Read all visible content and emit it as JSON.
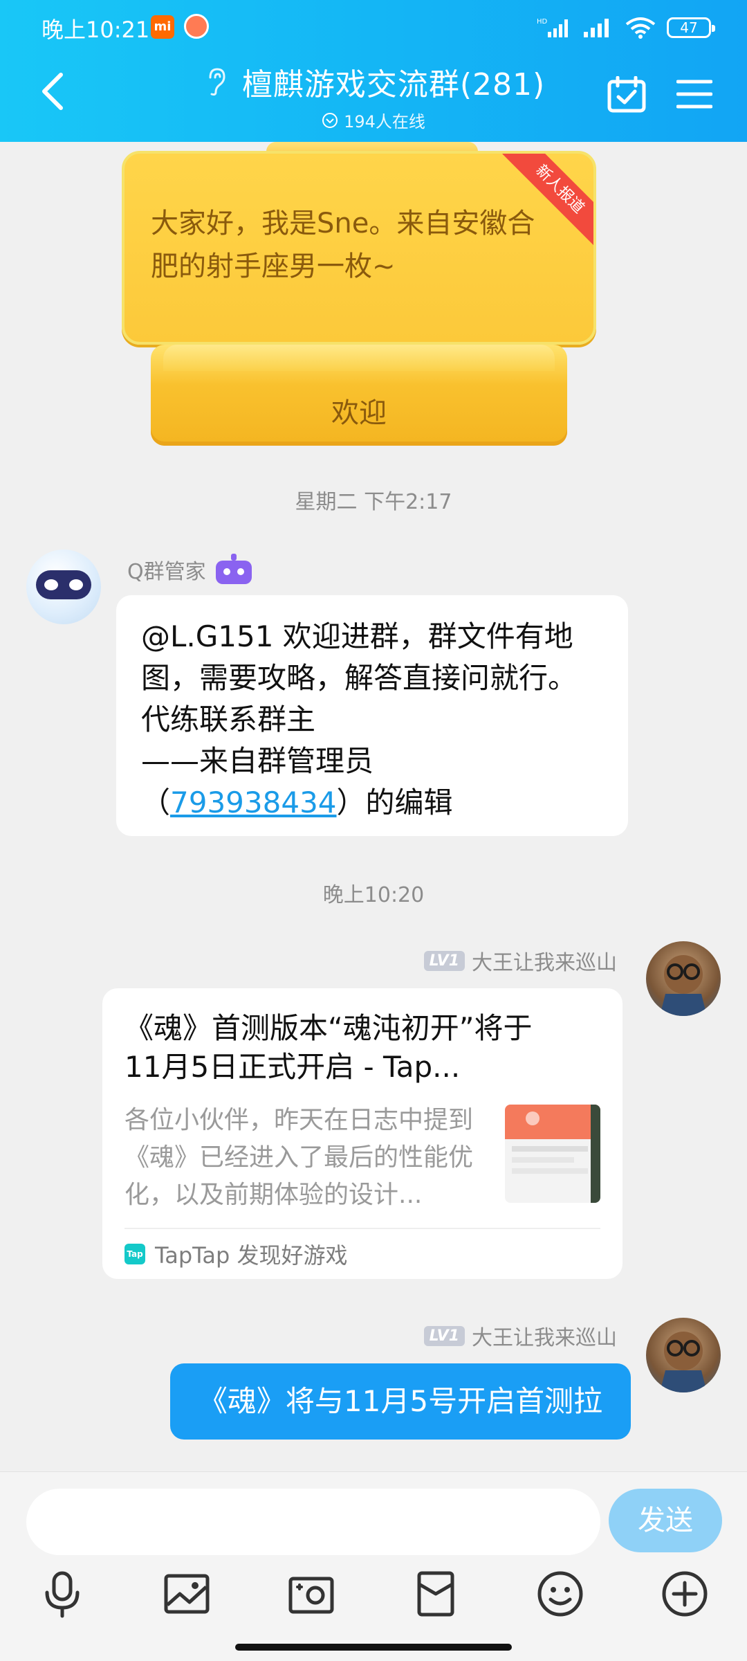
{
  "status_bar": {
    "time": "晚上10:21",
    "mi_badge": "mi",
    "battery": "47"
  },
  "header": {
    "title": "檀麒游戏交流群(281)",
    "online": "194人在线"
  },
  "welcome_card": {
    "text": "大家好，我是Sne。来自安徽合肥的射手座男一枚~",
    "ribbon": "新人报道",
    "button": "欢迎"
  },
  "timestamps": {
    "first": "星期二 下午2:17",
    "second": "晚上10:20"
  },
  "bot_message": {
    "sender": "Q群管家",
    "lines": [
      "@L.G151 欢迎进群，群文件有地",
      "图，需要攻略，解答直接问就行。",
      "代练联系群主",
      "——来自群管理员"
    ],
    "edit_prefix": "（",
    "qq_number": "793938434",
    "edit_suffix": "）的编辑"
  },
  "share_message": {
    "level": "LV1",
    "sender": "大王让我来巡山",
    "title": "《魂》首测版本“魂沌初开”将于11月5日正式开启 - Tap...",
    "description": "各位小伙伴，昨天在日志中提到《魂》已经进入了最后的性能优化，以及前期体验的设计...",
    "source_icon": "Tap",
    "source": "TapTap 发现好游戏"
  },
  "text_message": {
    "level": "LV1",
    "sender": "大王让我来巡山",
    "text": "《魂》将与11月5号开启首测拉"
  },
  "input": {
    "placeholder": "",
    "send_label": "发送"
  },
  "toolbar": {
    "icons": [
      "mic-icon",
      "image-icon",
      "camera-icon",
      "red-packet-icon",
      "emoji-icon",
      "plus-icon"
    ]
  },
  "colors": {
    "header_gradient_start": "#19c7f7",
    "header_gradient_end": "#12a5f4",
    "bubble_blue": "#1a9ef5",
    "send_disabled": "#8fd1f7",
    "welcome_yellow": "#fcc93a",
    "ribbon_red": "#f24a3d"
  }
}
